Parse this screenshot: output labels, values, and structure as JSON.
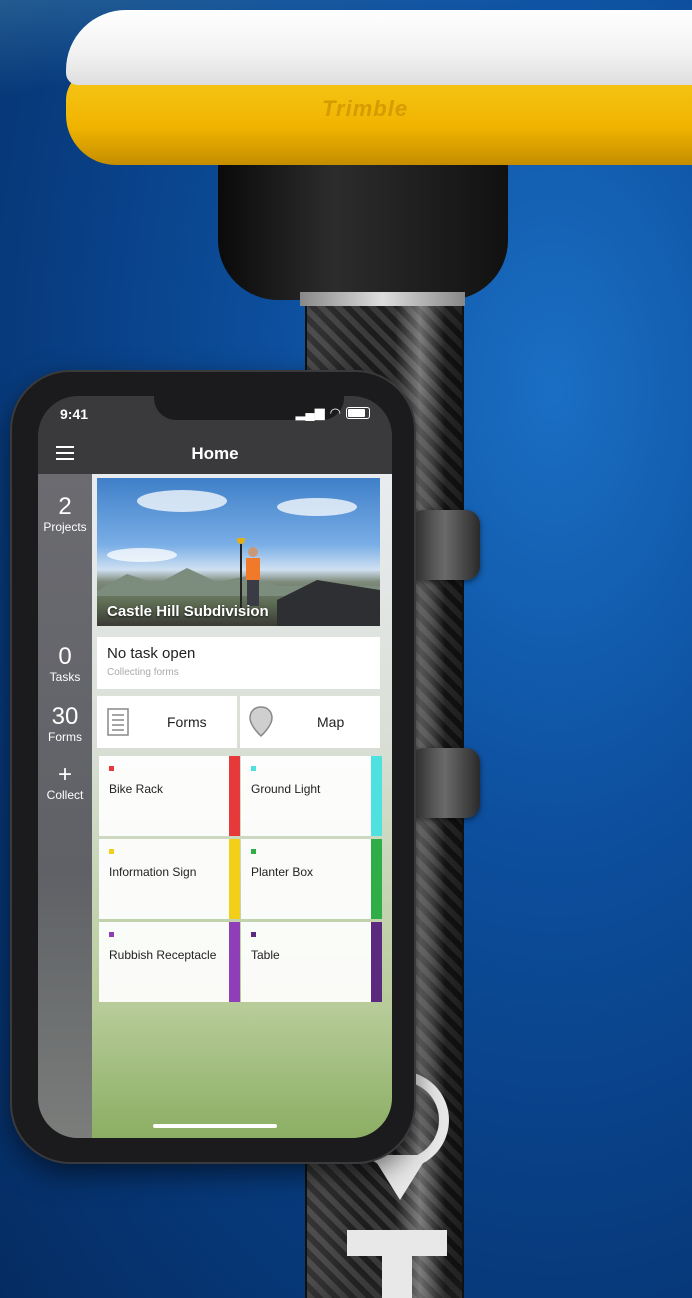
{
  "device": {
    "brand_mark": "Trimble",
    "status_time": "9:41"
  },
  "header": {
    "title": "Home"
  },
  "sidebar": {
    "items": [
      {
        "count": "2",
        "label": "Projects"
      },
      {
        "count": "0",
        "label": "Tasks"
      },
      {
        "count": "30",
        "label": "Forms"
      },
      {
        "count": "+",
        "label": "Collect"
      }
    ]
  },
  "project": {
    "name": "Castle Hill Subdivision"
  },
  "task": {
    "title": "No task open",
    "subtitle": "Collecting forms"
  },
  "shortcuts": {
    "forms_label": "Forms",
    "map_label": "Map"
  },
  "form_types": [
    {
      "name": "Bike Rack",
      "color": "#e63a3a"
    },
    {
      "name": "Ground Light",
      "color": "#4fe0e0"
    },
    {
      "name": "Information Sign",
      "color": "#f2d019"
    },
    {
      "name": "Planter Box",
      "color": "#2fae47"
    },
    {
      "name": "Rubbish Receptacle",
      "color": "#8e3fb8"
    },
    {
      "name": "Table",
      "color": "#5b2a7e"
    }
  ]
}
